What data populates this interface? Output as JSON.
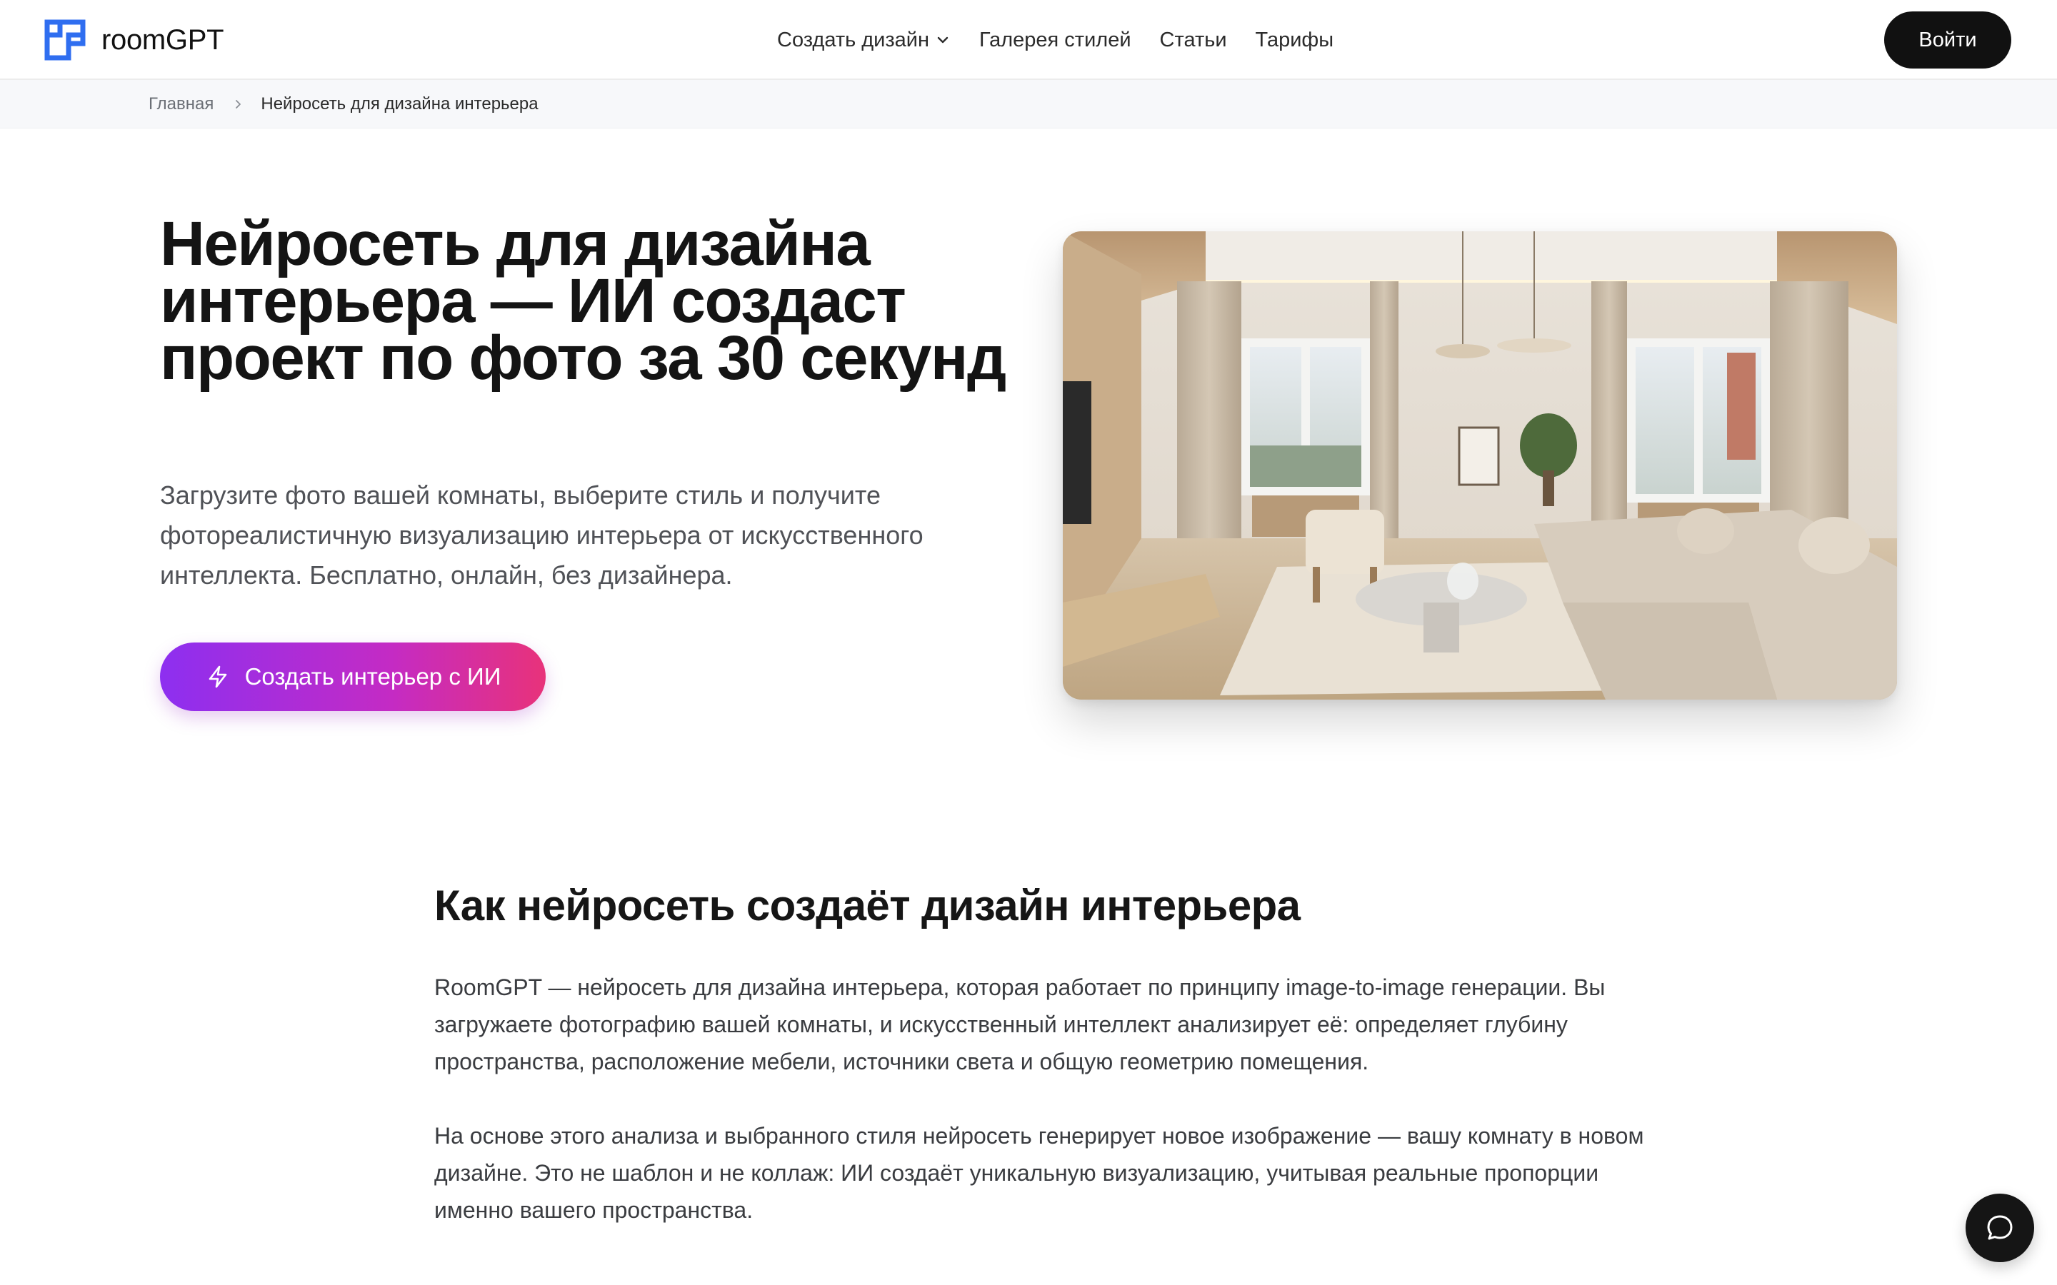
{
  "header": {
    "logo_text": "roomGPT",
    "nav": [
      {
        "label": "Создать дизайн",
        "has_dropdown": true
      },
      {
        "label": "Галерея стилей"
      },
      {
        "label": "Статьи"
      },
      {
        "label": "Тарифы"
      }
    ],
    "login_label": "Войти"
  },
  "breadcrumb": {
    "home": "Главная",
    "current": "Нейросеть для дизайна интерьера"
  },
  "hero": {
    "title": "Нейросеть для дизайна интерьера — ИИ создаст проект по фото за 30 секунд",
    "subtitle": "Загрузите фото вашей комнаты, выберите стиль и получите фотореалистичную визуализацию интерьера от искусственного интеллекта. Бесплатно, онлайн, без дизайнера.",
    "cta_label": "Создать интерьер с ИИ",
    "cta_icon": "lightning-icon"
  },
  "section": {
    "title": "Как нейросеть создаёт дизайн интерьера",
    "paragraph1": "RoomGPT — нейросеть для дизайна интерьера, которая работает по принципу image-to-image генерации. Вы загружаете фотографию вашей комнаты, и искусственный интеллект анализирует её: определяет глубину пространства, расположение мебели, источники света и общую геометрию помещения.",
    "paragraph2": "На основе этого анализа и выбранного стиля нейросеть генерирует новое изображение — вашу комнату в новом дизайне. Это не шаблон и не коллаж: ИИ создаёт уникальную визуализацию, учитывая реальные пропорции именно вашего пространства."
  },
  "chat_icon": "chat-bubble-icon",
  "colors": {
    "brand_blue": "#2f6ef0",
    "cta_gradient_start": "#8d2ff0",
    "cta_gradient_end": "#e8327a",
    "dark": "#111111"
  }
}
